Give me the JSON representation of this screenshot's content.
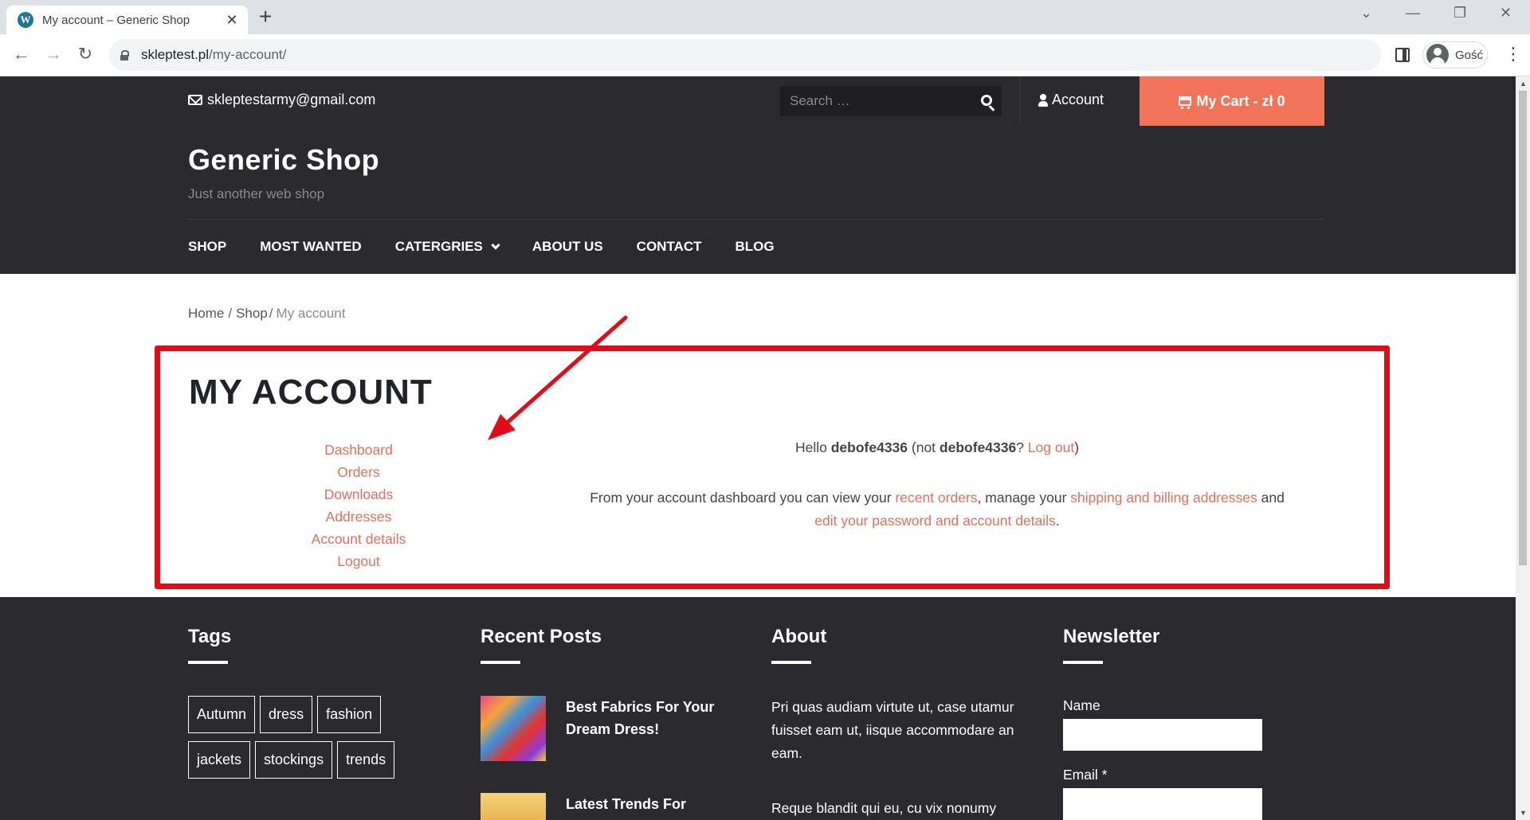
{
  "browser": {
    "tab_title": "My account – Generic Shop",
    "favicon": "W",
    "url_domain": "skleptest.pl",
    "url_path": "/my-account/",
    "profile_name": "Gość"
  },
  "topbar": {
    "email": "skleptestarmy@gmail.com",
    "search_placeholder": "Search …",
    "account_label": "Account",
    "cart_label": "My Cart - zł 0"
  },
  "header": {
    "site_title": "Generic Shop",
    "tagline": "Just another web shop",
    "nav": [
      "SHOP",
      "MOST WANTED",
      "CATERGRIES",
      "ABOUT US",
      "CONTACT",
      "BLOG"
    ]
  },
  "breadcrumb": {
    "home": "Home",
    "shop": "Shop",
    "current": "My account",
    "sep": "/"
  },
  "account": {
    "title": "MY ACCOUNT",
    "nav": [
      "Dashboard",
      "Orders",
      "Downloads",
      "Addresses",
      "Account details",
      "Logout"
    ],
    "hello_prefix": "Hello ",
    "username": "debofe4336",
    "hello_mid": " (not ",
    "username2": "debofe4336",
    "hello_q": "? ",
    "logout_link": "Log out",
    "hello_end": ")",
    "dash_1": "From your account dashboard you can view your ",
    "dash_link1": "recent orders",
    "dash_2": ", manage your ",
    "dash_link2": "shipping and billing addresses",
    "dash_3": " and ",
    "dash_link3": "edit your password and account details",
    "dash_4": "."
  },
  "footer": {
    "tags_heading": "Tags",
    "tags": [
      "Autumn",
      "dress",
      "fashion",
      "jackets",
      "stockings",
      "trends"
    ],
    "recent_heading": "Recent Posts",
    "posts": [
      "Best Fabrics For Your Dream Dress!",
      "Latest Trends For"
    ],
    "about_heading": "About",
    "about_1": "Pri quas audiam virtute ut, case utamur fuisset eam ut, iisque accommodare an eam.",
    "about_2": "Reque blandit qui eu, cu vix nonumy",
    "newsletter_heading": "Newsletter",
    "name_label": "Name",
    "email_label": "Email *"
  },
  "colors": {
    "accent": "#f0735a",
    "link": "#e0705c",
    "dark_bg": "#2a2a2f",
    "annotation_red": "#e00d18"
  }
}
